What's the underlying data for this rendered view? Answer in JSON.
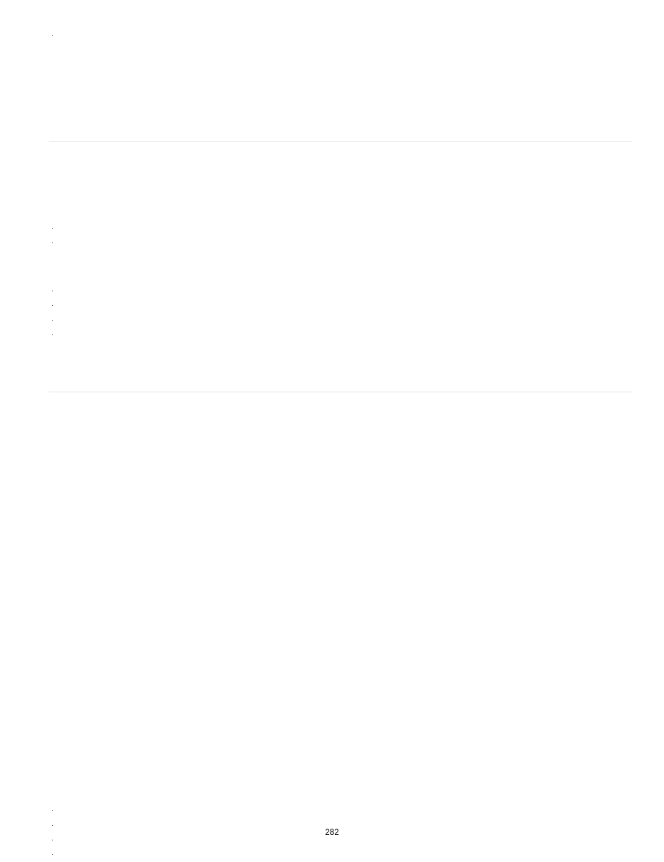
{
  "page_number": "282",
  "groups": {
    "g1": {
      "items": [
        ""
      ]
    },
    "g2": {
      "items": [
        "",
        ""
      ]
    },
    "g3": {
      "items": [
        "",
        "",
        "",
        ""
      ]
    },
    "g4": {
      "items": [
        "",
        "",
        "",
        ""
      ]
    }
  }
}
